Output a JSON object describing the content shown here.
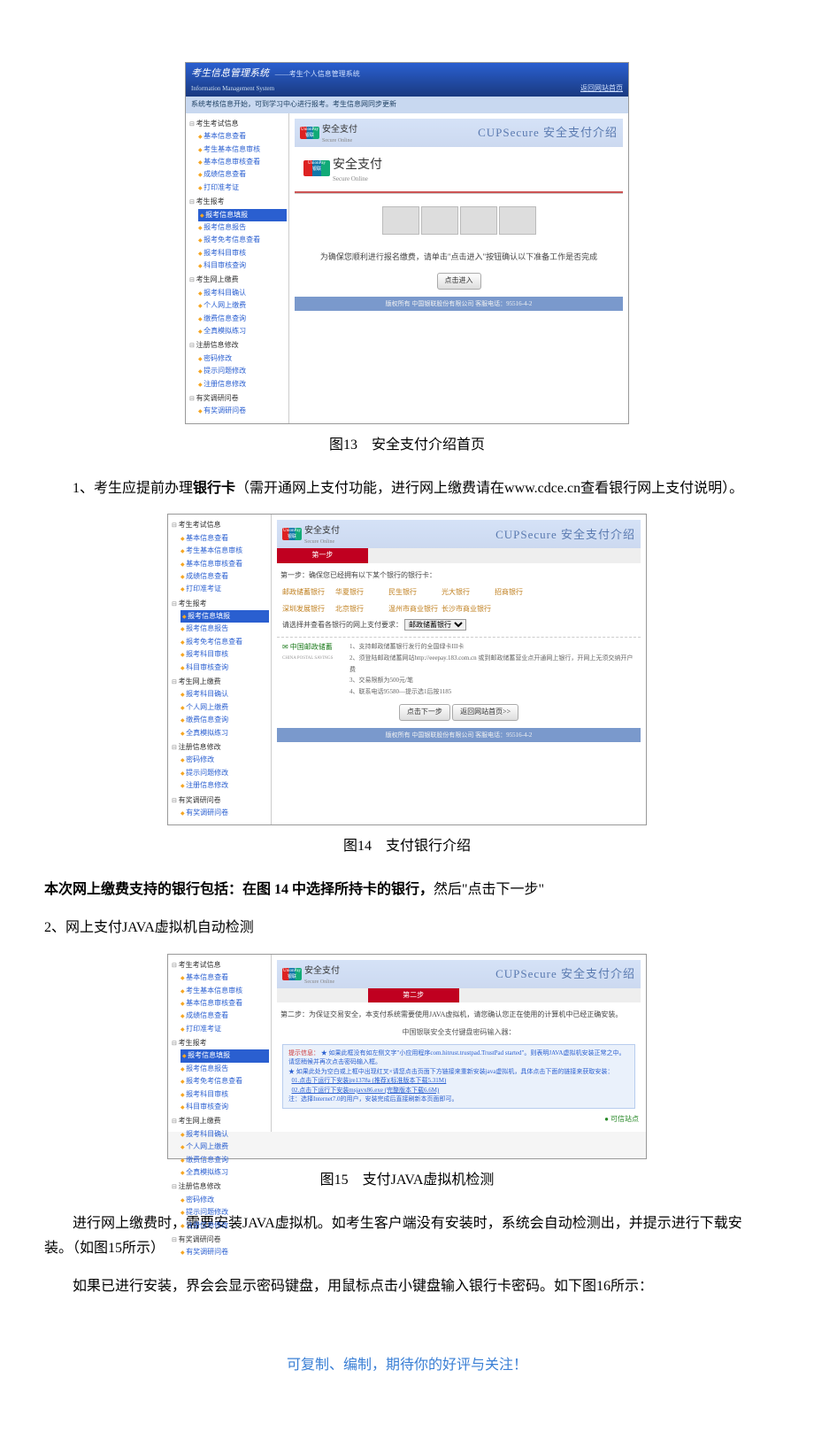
{
  "app": {
    "title": "考生信息管理系统",
    "subtitle": "——考生个人信息管理系统",
    "eng": "Information Management System",
    "tip_bar": "系统考核信息开始，可到学习中心进行报考。考生信息网同步更新",
    "back_link": "返回网站首页"
  },
  "sidebar": {
    "groups": [
      {
        "label": "考生考试信息",
        "items": [
          "基本信息查看",
          "考生基本信息审核",
          "基本信息审核查看",
          "成绩信息查看",
          "打印准考证"
        ]
      },
      {
        "label": "考生报考",
        "items_active": 0,
        "items": [
          "报考信息填报",
          "报考信息报告",
          "报考免考信息查看",
          "报考科目审核",
          "科目审核查询"
        ]
      },
      {
        "label": "考生网上缴费",
        "items": [
          "报考科目确认",
          "个人网上缴费",
          "缴费信息查询",
          "全真模拟练习"
        ]
      },
      {
        "label": "注册信息修改",
        "items": [
          "密码修改",
          "提示问题修改",
          "注册信息修改"
        ]
      },
      {
        "label": "有奖调研问卷",
        "items": [
          "有奖调研问卷"
        ]
      }
    ]
  },
  "unionpay": {
    "mark_top": "UnionPay",
    "mark_bottom": "银联",
    "cn": "安全支付",
    "en": "Secure Online",
    "banner_right": "CUPSecure 安全支付介绍"
  },
  "fig13": {
    "notice": "为确保您顺利进行报名缴费，请单击\"点击进入\"按钮确认以下准备工作是否完成",
    "btn": "点击进入",
    "footer": "版权所有 中国银联股份有限公司  客服电话：95516-4-2",
    "caption": "图13　安全支付介绍首页"
  },
  "para1_prefix": "1、考生应提前办理",
  "para1_bold": "银行卡",
  "para1_suffix": "（需开通网上支付功能，进行网上缴费请在www.cdce.cn查看银行网上支付说明）。",
  "fig14": {
    "step1_tab": "第一步",
    "step1_text": "第一步：确保您已经拥有以下某个银行的银行卡：",
    "banks_row1": [
      "邮政储蓄银行",
      "华夏银行",
      "民生银行",
      "光大银行",
      "招商银行"
    ],
    "banks_row2": [
      "深圳发展银行",
      "北京银行",
      "温州市商业银行",
      "长沙市商业银行"
    ],
    "select_label": "请选择并查看各银行的网上支付要求：",
    "select_value": "邮政储蓄银行",
    "bank_logo": "中国邮政储蓄",
    "bank_logo_en": "CHINA POSTAL SAVINGS",
    "bank_info": [
      "1、支持邮政储蓄银行发行的全国绿卡III卡",
      "2、须登陆邮政储蓄网站http://eeepay.183.com.cn 或到邮政储蓄营业点开通网上银行，开网上无须交纳开户费",
      "3、交易限额为500元/笔",
      "4、联系电话95580—提示选1后按1185"
    ],
    "btn_next": "点击下一步",
    "btn_back": "返回网站首页>>",
    "caption": "图14　支付银行介绍"
  },
  "para2_bold": "本次网上缴费支持的银行包括：在图 14 中选择所持卡的银行，",
  "para2_rest": "然后\"点击下一步\"",
  "para3": "2、网上支付JAVA虚拟机自动检测",
  "fig15": {
    "step2_tab": "第二步",
    "step2_text": "第二步：为保证交易安全，本支付系统需要使用JAVA虚拟机，请您确认您正在使用的计算机中已经正确安装。",
    "keypad_label": "中国银联安全支付键盘密码输入器：",
    "tip_head": "提示信息：",
    "tip_body": "★ 如果此框没有如左侧文字\"小应用程序com.hitrust.trustpad.TrustPad started\"。则表明JAVA虚拟机安装正常之中。请您稍候并再次点击密码输入框。",
    "tip_body2": "★ 如果此处为空白或上框中出现红叉×请您点击页面下方链接来重新安装java虚拟机，具体点击下面的链接来获取安装：",
    "tip_link1": "01.点击下运行下安装jre1378a (推荐)(标准版本下载5.31M)",
    "tip_link2": "02.点击下运行下安装msjavx86.exe (完整版本下载6.6M)",
    "tip_note": "注：选择Internet7.0的用户，安装完成后直接刷新本页面即可。",
    "status": "可信站点",
    "caption": "图15　支付JAVA虚拟机检测"
  },
  "para4": "进行网上缴费时，需要安装JAVA虚拟机。如考生客户端没有安装时，系统会自动检测出，并提示进行下载安装。（如图15所示）",
  "para5": "如果已进行安装，界会会显示密码键盘，用鼠标点击小键盘输入银行卡密码。如下图16所示：",
  "footer": "可复制、编制，期待你的好评与关注！"
}
